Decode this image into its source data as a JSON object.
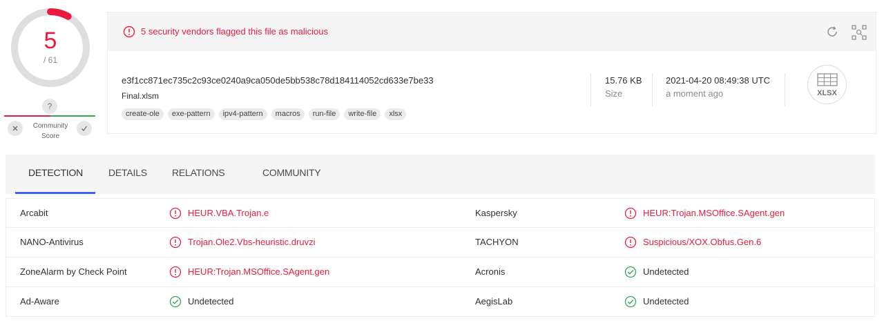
{
  "score": {
    "detected": "5",
    "total": "/ 61",
    "unknown_mark": "?",
    "community_label_1": "Community",
    "community_label_2": "Score",
    "malicious_fraction": 0.082
  },
  "alert": {
    "text": "5 security vendors flagged this file as malicious",
    "color": "#e91c3f"
  },
  "file": {
    "hash": "e3f1cc871ec735c2c93ce0240a9ca050de5bb538c78d184114052cd633e7be33",
    "name": "Final.xlsm",
    "tags": [
      "create-ole",
      "exe-pattern",
      "ipv4-pattern",
      "macros",
      "run-file",
      "write-file",
      "xlsx"
    ],
    "size_value": "15.76 KB",
    "size_label": "Size",
    "date_value": "2021-04-20 08:49:38 UTC",
    "date_ago": "a moment ago",
    "type_label": "XLSX"
  },
  "tabs": [
    "DETECTION",
    "DETAILS",
    "RELATIONS",
    "COMMUNITY"
  ],
  "detections": [
    {
      "left": {
        "engine": "Arcabit",
        "result": "HEUR.VBA.Trojan.e",
        "status": "malicious"
      },
      "right": {
        "engine": "Kaspersky",
        "result": "HEUR:Trojan.MSOffice.SAgent.gen",
        "status": "malicious"
      }
    },
    {
      "left": {
        "engine": "NANO-Antivirus",
        "result": "Trojan.Ole2.Vbs-heuristic.druvzi",
        "status": "malicious"
      },
      "right": {
        "engine": "TACHYON",
        "result": "Suspicious/XOX.Obfus.Gen.6",
        "status": "malicious"
      }
    },
    {
      "left": {
        "engine": "ZoneAlarm by Check Point",
        "result": "HEUR:Trojan.MSOffice.SAgent.gen",
        "status": "malicious"
      },
      "right": {
        "engine": "Acronis",
        "result": "Undetected",
        "status": "clean"
      }
    },
    {
      "left": {
        "engine": "Ad-Aware",
        "result": "Undetected",
        "status": "clean"
      },
      "right": {
        "engine": "AegisLab",
        "result": "Undetected",
        "status": "clean"
      }
    }
  ],
  "icons": {
    "alert": "alert-circle-icon",
    "reanalyze": "reanalyze-icon",
    "similar": "similar-search-icon",
    "malicious": "alert-circle-icon",
    "clean": "check-circle-icon",
    "file_type": "xlsx-file-icon"
  }
}
